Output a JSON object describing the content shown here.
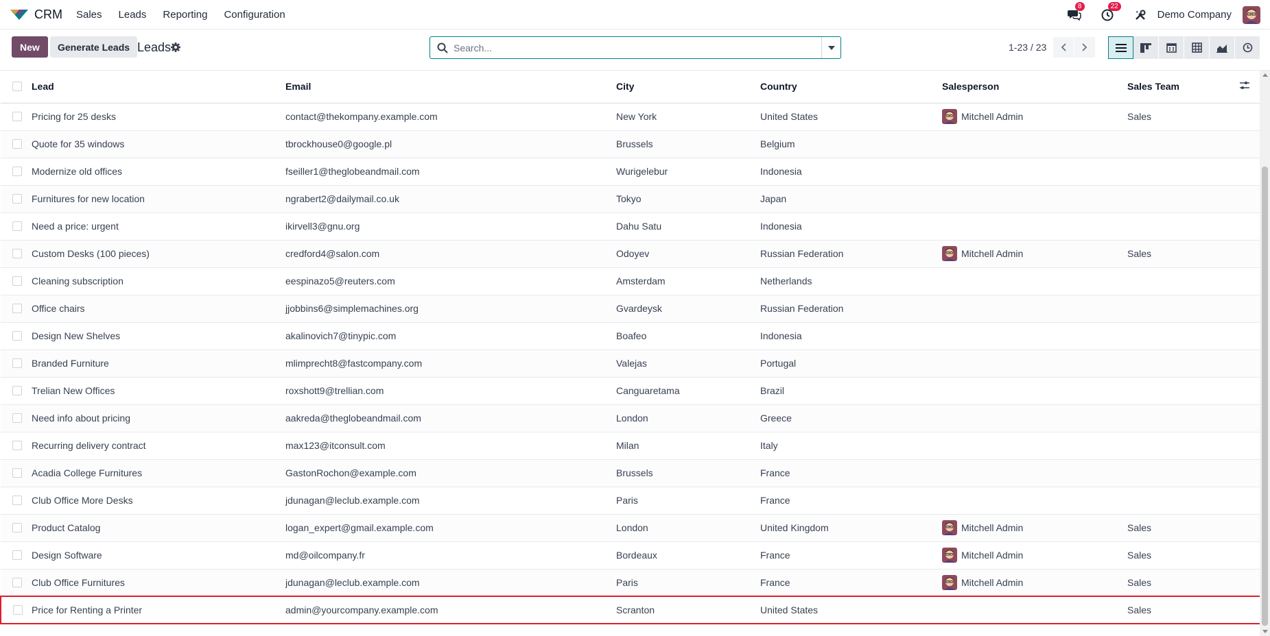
{
  "navbar": {
    "app_name": "CRM",
    "menu": [
      "Sales",
      "Leads",
      "Reporting",
      "Configuration"
    ],
    "messages_count": "8",
    "activities_count": "22",
    "company": "Demo Company"
  },
  "control": {
    "new_label": "New",
    "generate_label": "Generate Leads",
    "title": "Leads",
    "search_placeholder": "Search...",
    "pager": "1-23 / 23"
  },
  "table": {
    "headers": [
      "Lead",
      "Email",
      "City",
      "Country",
      "Salesperson",
      "Sales Team"
    ],
    "rows": [
      {
        "lead": "Pricing for 25 desks",
        "email": "contact@thekompany.example.com",
        "city": "New York",
        "country": "United States",
        "salesperson": "Mitchell Admin",
        "team": "Sales"
      },
      {
        "lead": "Quote for 35 windows",
        "email": "tbrockhouse0@google.pl",
        "city": "Brussels",
        "country": "Belgium",
        "salesperson": "",
        "team": ""
      },
      {
        "lead": "Modernize old offices",
        "email": "fseiller1@theglobeandmail.com",
        "city": "Wurigelebur",
        "country": "Indonesia",
        "salesperson": "",
        "team": ""
      },
      {
        "lead": "Furnitures for new location",
        "email": "ngrabert2@dailymail.co.uk",
        "city": "Tokyo",
        "country": "Japan",
        "salesperson": "",
        "team": ""
      },
      {
        "lead": "Need a price: urgent",
        "email": "ikirvell3@gnu.org",
        "city": "Dahu Satu",
        "country": "Indonesia",
        "salesperson": "",
        "team": ""
      },
      {
        "lead": "Custom Desks (100 pieces)",
        "email": "credford4@salon.com",
        "city": "Odoyev",
        "country": "Russian Federation",
        "salesperson": "Mitchell Admin",
        "team": "Sales"
      },
      {
        "lead": "Cleaning subscription",
        "email": "eespinazo5@reuters.com",
        "city": "Amsterdam",
        "country": "Netherlands",
        "salesperson": "",
        "team": ""
      },
      {
        "lead": "Office chairs",
        "email": "jjobbins6@simplemachines.org",
        "city": "Gvardeysk",
        "country": "Russian Federation",
        "salesperson": "",
        "team": ""
      },
      {
        "lead": "Design New Shelves",
        "email": "akalinovich7@tinypic.com",
        "city": "Boafeo",
        "country": "Indonesia",
        "salesperson": "",
        "team": ""
      },
      {
        "lead": "Branded Furniture",
        "email": "mlimprecht8@fastcompany.com",
        "city": "Valejas",
        "country": "Portugal",
        "salesperson": "",
        "team": ""
      },
      {
        "lead": "Trelian New Offices",
        "email": "roxshott9@trellian.com",
        "city": "Canguaretama",
        "country": "Brazil",
        "salesperson": "",
        "team": ""
      },
      {
        "lead": "Need info about pricing",
        "email": "aakreda@theglobeandmail.com",
        "city": "London",
        "country": "Greece",
        "salesperson": "",
        "team": ""
      },
      {
        "lead": "Recurring delivery contract",
        "email": "max123@itconsult.com",
        "city": "Milan",
        "country": "Italy",
        "salesperson": "",
        "team": ""
      },
      {
        "lead": "Acadia College Furnitures",
        "email": "GastonRochon@example.com",
        "city": "Brussels",
        "country": "France",
        "salesperson": "",
        "team": ""
      },
      {
        "lead": "Club Office More Desks",
        "email": "jdunagan@leclub.example.com",
        "city": "Paris",
        "country": "France",
        "salesperson": "",
        "team": ""
      },
      {
        "lead": "Product Catalog",
        "email": "logan_expert@gmail.example.com",
        "city": "London",
        "country": "United Kingdom",
        "salesperson": "Mitchell Admin",
        "team": "Sales"
      },
      {
        "lead": "Design Software",
        "email": "md@oilcompany.fr",
        "city": "Bordeaux",
        "country": "France",
        "salesperson": "Mitchell Admin",
        "team": "Sales"
      },
      {
        "lead": "Club Office Furnitures",
        "email": "jdunagan@leclub.example.com",
        "city": "Paris",
        "country": "France",
        "salesperson": "Mitchell Admin",
        "team": "Sales"
      },
      {
        "lead": "Price for Renting a Printer",
        "email": "admin@yourcompany.example.com",
        "city": "Scranton",
        "country": "United States",
        "salesperson": "",
        "team": "Sales",
        "highlighted": true
      }
    ]
  },
  "colors": {
    "brand": "#714b67",
    "accent": "#017e84",
    "highlight": "#e11d2a"
  }
}
